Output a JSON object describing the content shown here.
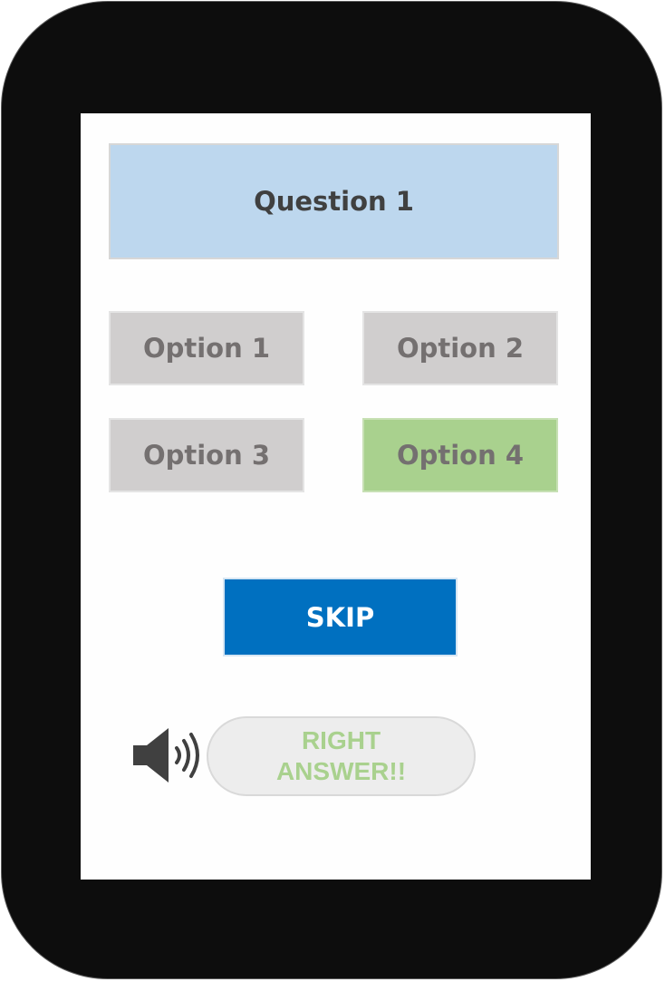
{
  "question": {
    "label": "Question 1"
  },
  "options": [
    {
      "label": "Option 1"
    },
    {
      "label": "Option 2"
    },
    {
      "label": "Option 3"
    },
    {
      "label": "Option 4",
      "state": "correct",
      "color": "#a9d18e"
    }
  ],
  "skip": {
    "label": "SKIP",
    "color": "#0070c0"
  },
  "feedback": {
    "icon": "speaker-icon",
    "message": "RIGHT ANSWER!!",
    "color": "#a9d18e"
  }
}
